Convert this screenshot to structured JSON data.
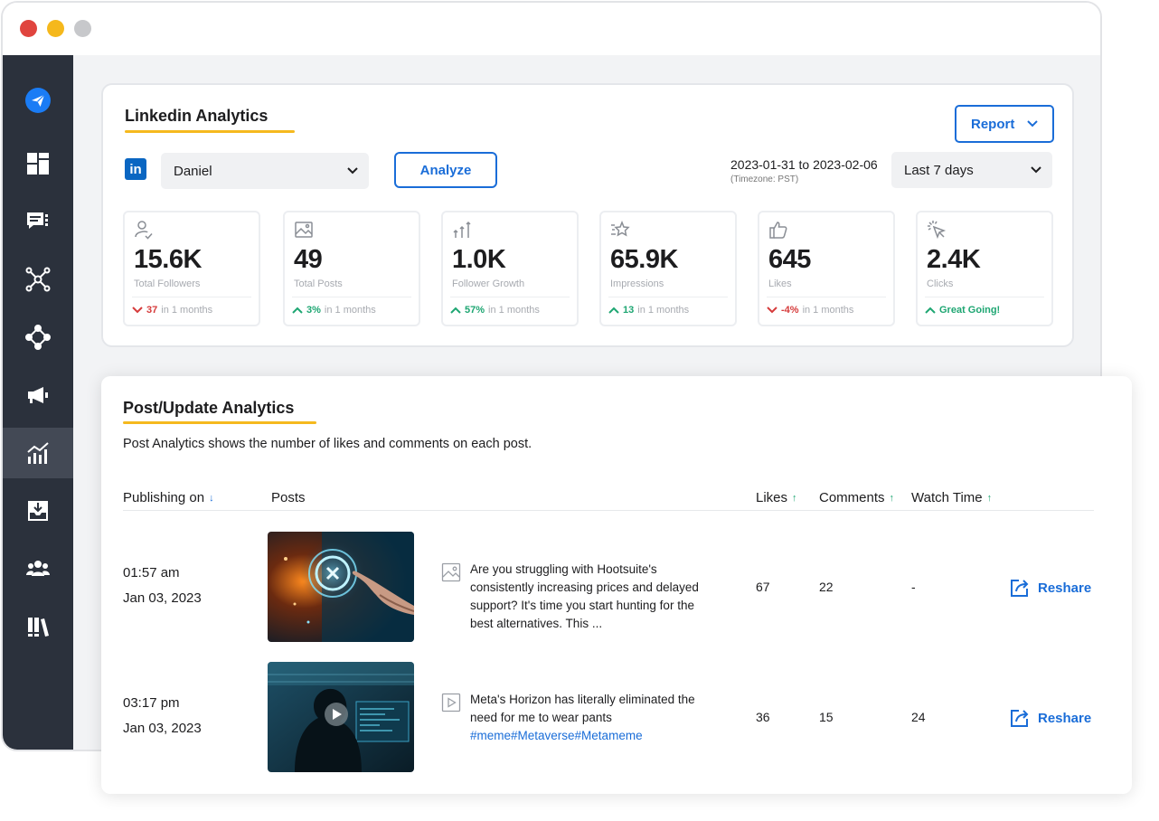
{
  "colors": {
    "accent": "#1a6dd8",
    "sidebar": "#2b313c",
    "underline": "#f5b91e",
    "up": "#1ea672",
    "down": "#d63b3b"
  },
  "sidebar": {
    "items": [
      {
        "icon": "paper-plane-icon"
      },
      {
        "icon": "dashboard-icon"
      },
      {
        "icon": "chat-icon"
      },
      {
        "icon": "network-icon"
      },
      {
        "icon": "integrations-icon"
      },
      {
        "icon": "megaphone-icon"
      },
      {
        "icon": "analytics-icon",
        "active": true
      },
      {
        "icon": "inbox-icon"
      },
      {
        "icon": "team-icon"
      },
      {
        "icon": "library-icon"
      }
    ]
  },
  "linkedin": {
    "title": "Linkedin Analytics",
    "report_label": "Report",
    "logo_text": "in",
    "account": "Daniel",
    "analyze_label": "Analyze",
    "date_range": "2023-01-31 to 2023-02-06",
    "timezone": "(Timezone: PST)",
    "period": "Last 7 days",
    "stats": [
      {
        "icon": "user-check-icon",
        "value": "15.6K",
        "label": "Total Followers",
        "direction": "down",
        "change": "37",
        "period": "in 1 months"
      },
      {
        "icon": "image-icon",
        "value": "49",
        "label": "Total Posts",
        "direction": "up",
        "change": "3%",
        "period": "in 1 months"
      },
      {
        "icon": "growth-arrows-icon",
        "value": "1.0K",
        "label": "Follower Growth",
        "direction": "up",
        "change": "57%",
        "period": "in 1 months"
      },
      {
        "icon": "star-icon",
        "value": "65.9K",
        "label": "Impressions",
        "direction": "up",
        "change": "13",
        "period": "in 1 months"
      },
      {
        "icon": "thumbs-up-icon",
        "value": "645",
        "label": "Likes",
        "direction": "down",
        "change": "-4%",
        "period": "in 1 months"
      },
      {
        "icon": "cursor-click-icon",
        "value": "2.4K",
        "label": "Clicks",
        "direction": "up",
        "change": "Great Going!",
        "period": ""
      }
    ]
  },
  "posts": {
    "title": "Post/Update Analytics",
    "description": "Post Analytics shows the number of likes and comments on each post.",
    "columns": {
      "publishing": "Publishing on",
      "posts": "Posts",
      "likes": "Likes",
      "comments": "Comments",
      "watch_time": "Watch Time"
    },
    "rows": [
      {
        "time": "01:57 am",
        "date": "Jan 03, 2023",
        "type": "image-icon",
        "text": "Are you struggling with Hootsuite's consistently increasing prices and delayed support? It's time you start hunting for the best alternatives. This ...",
        "hashtags": "",
        "likes": "67",
        "comments": "22",
        "watch_time": "-",
        "action": "Reshare"
      },
      {
        "time": "03:17 pm",
        "date": "Jan 03, 2023",
        "type": "video-icon",
        "text": "Meta's Horizon has literally eliminated the need for me to wear pants",
        "hashtags": "#meme#Metaverse#Metameme",
        "likes": "36",
        "comments": "15",
        "watch_time": "24",
        "action": "Reshare"
      }
    ]
  }
}
